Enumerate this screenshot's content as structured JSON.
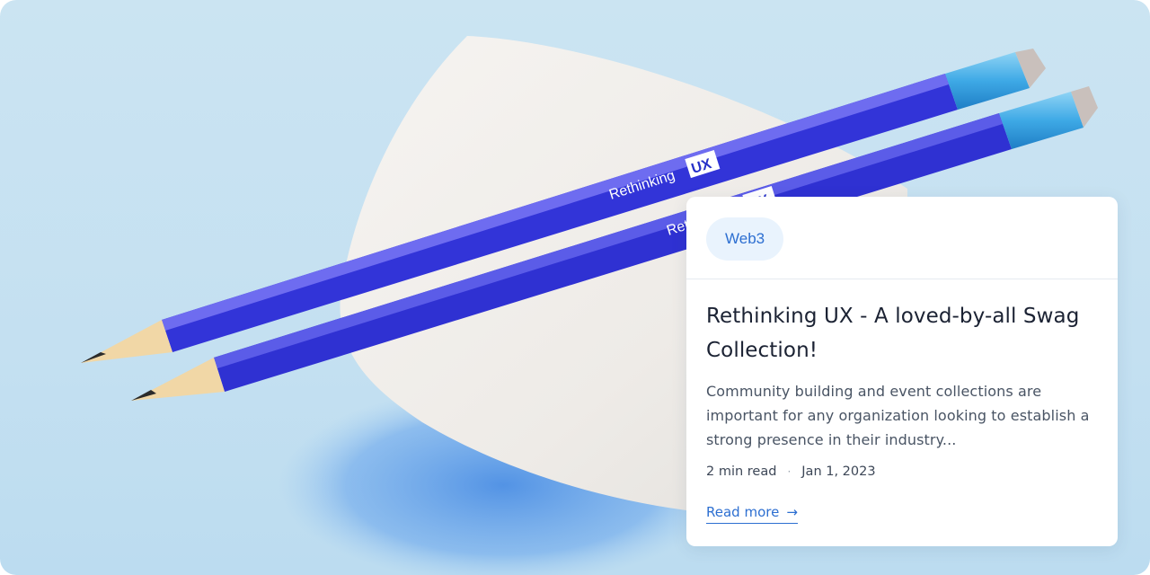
{
  "card": {
    "tag": "Web3",
    "title": "Rethinking UX - A loved-by-all Swag Collection!",
    "excerpt": "Community building and event collections are important for any organization looking to establish a strong presence in their industry...",
    "read_time": "2 min read",
    "separator": "·",
    "date": "Jan 1, 2023",
    "read_more": "Read more",
    "arrow_glyph": "→"
  },
  "image": {
    "pencil_brand": "Rethinking",
    "pencil_badge": "UX"
  },
  "colors": {
    "background": "#c7e2f2",
    "pencil_body": "#3033d6",
    "accent": "#2d6fd1",
    "tag_background": "#e9f3fd"
  }
}
